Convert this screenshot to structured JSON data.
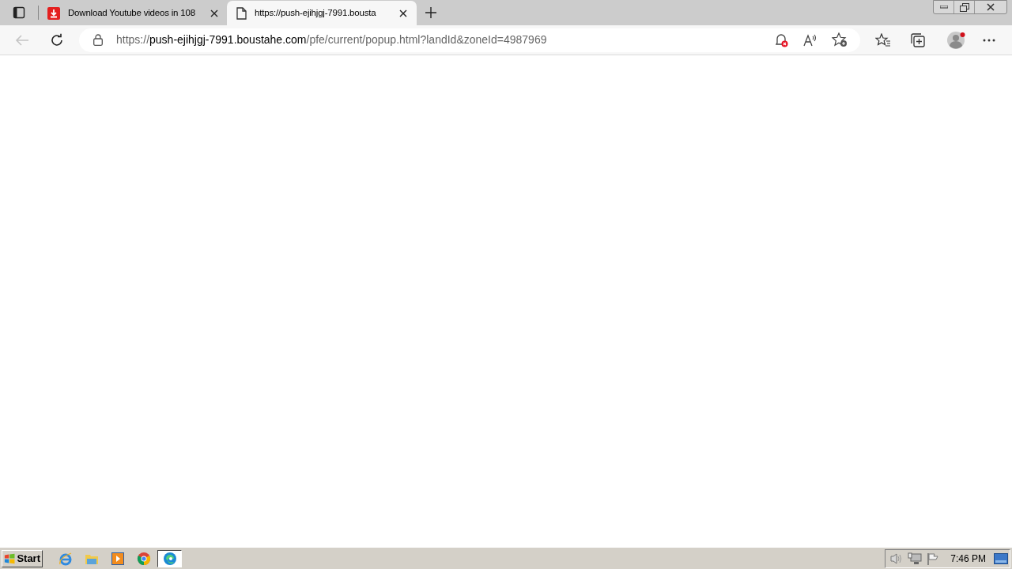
{
  "tabs": [
    {
      "kind": "download",
      "title": "Download Youtube videos in 108",
      "selected": false
    },
    {
      "kind": "page",
      "title": "https://push-ejihjgj-7991.bousta",
      "selected": true
    }
  ],
  "address_bar": {
    "scheme": "https://",
    "host": "push-ejihjgj-7991.boustahe.com",
    "path": "/pfe/current/popup.html?landId&zoneId=4987969"
  },
  "taskbar": {
    "start_label": "Start",
    "apps": [
      {
        "kind": "ie",
        "selected": false
      },
      {
        "kind": "folder",
        "selected": false
      },
      {
        "kind": "media",
        "selected": false
      },
      {
        "kind": "chrome",
        "selected": false
      },
      {
        "kind": "edge",
        "selected": true
      }
    ],
    "clock": "7:46 PM"
  }
}
